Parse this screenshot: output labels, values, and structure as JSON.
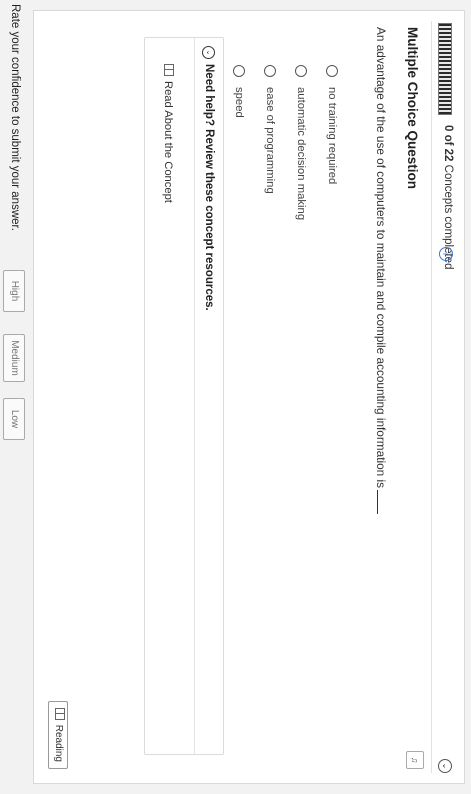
{
  "progress": {
    "count": "0 of 22",
    "label": "Concepts completed",
    "fraction_completed": 0
  },
  "question": {
    "type_label": "Multiple Choice Question",
    "prompt": "An advantage of the use of computers to maintain and compile accounting information is",
    "choices": [
      {
        "label": "no training required"
      },
      {
        "label": "automatic decision making"
      },
      {
        "label": "ease of programming"
      },
      {
        "label": "speed"
      }
    ]
  },
  "help": {
    "title": "Need help? Review these concept resources.",
    "link_label": "Read About the Concept"
  },
  "reading_button": "Reading",
  "footer": {
    "rate_text": "Rate your confidence to submit your answer.",
    "buttons": [
      "High",
      "Medium",
      "Low"
    ]
  },
  "icons": [
    "info-icon",
    "collapse-icon",
    "audio-icon",
    "chevron-down-icon",
    "book-icon"
  ]
}
